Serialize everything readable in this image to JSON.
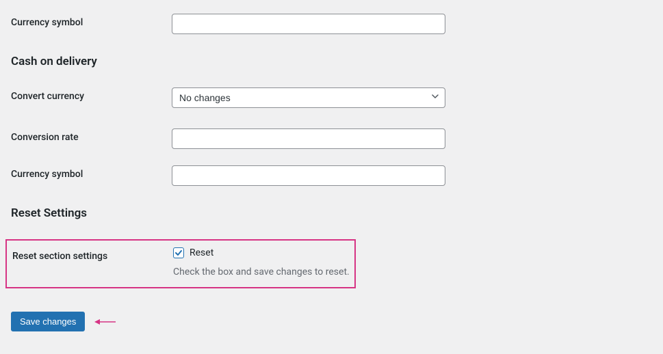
{
  "fields": {
    "currency_symbol_1": {
      "label": "Currency symbol",
      "value": ""
    },
    "currency_symbol_2": {
      "label": "Currency symbol",
      "value": ""
    },
    "convert_currency": {
      "label": "Convert currency",
      "selected": "No changes"
    },
    "conversion_rate": {
      "label": "Conversion rate",
      "value": ""
    },
    "reset_section": {
      "label": "Reset section settings",
      "checkbox_label": "Reset",
      "description": "Check the box and save changes to reset."
    }
  },
  "sections": {
    "cash_on_delivery": "Cash on delivery",
    "reset_settings": "Reset Settings"
  },
  "buttons": {
    "save": "Save changes"
  }
}
